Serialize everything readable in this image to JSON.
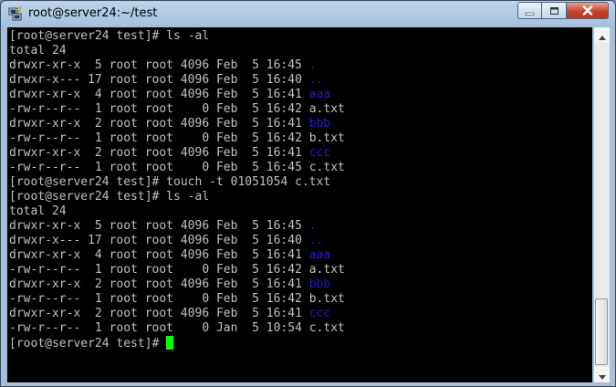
{
  "window": {
    "title": "root@server24:~/test"
  },
  "icons": {
    "app": "putty-icon",
    "minimize": "minimize-icon",
    "maximize": "maximize-icon",
    "close": "close-icon",
    "scroll_up": "arrow-up-icon",
    "scroll_down": "arrow-down-icon"
  },
  "colors": {
    "terminal_bg": "#000000",
    "terminal_fg": "#c0c0c0",
    "directory": "#1f1fcf",
    "cursor": "#00ff00",
    "close_button": "#c7452f"
  },
  "terminal": {
    "lines": [
      {
        "text": "[root@server24 test]# ls -al"
      },
      {
        "text": "total 24"
      },
      {
        "text": "drwxr-xr-x  5 root root 4096 Feb  5 16:45 ",
        "name": "."
      },
      {
        "text": "drwxr-x--- 17 root root 4096 Feb  5 16:40 ",
        "name": ".."
      },
      {
        "text": "drwxr-xr-x  4 root root 4096 Feb  5 16:41 ",
        "name": "aaa"
      },
      {
        "text": "-rw-r--r--  1 root root    0 Feb  5 16:42 a.txt"
      },
      {
        "text": "drwxr-xr-x  2 root root 4096 Feb  5 16:41 ",
        "name": "bbb"
      },
      {
        "text": "-rw-r--r--  1 root root    0 Feb  5 16:42 b.txt"
      },
      {
        "text": "drwxr-xr-x  2 root root 4096 Feb  5 16:41 ",
        "name": "ccc"
      },
      {
        "text": "-rw-r--r--  1 root root    0 Feb  5 16:45 c.txt"
      },
      {
        "text": "[root@server24 test]# touch -t 01051054 c.txt"
      },
      {
        "text": "[root@server24 test]# ls -al"
      },
      {
        "text": "total 24"
      },
      {
        "text": "drwxr-xr-x  5 root root 4096 Feb  5 16:45 ",
        "name": "."
      },
      {
        "text": "drwxr-x--- 17 root root 4096 Feb  5 16:40 ",
        "name": ".."
      },
      {
        "text": "drwxr-xr-x  4 root root 4096 Feb  5 16:41 ",
        "name": "aaa"
      },
      {
        "text": "-rw-r--r--  1 root root    0 Feb  5 16:42 a.txt"
      },
      {
        "text": "drwxr-xr-x  2 root root 4096 Feb  5 16:41 ",
        "name": "bbb"
      },
      {
        "text": "-rw-r--r--  1 root root    0 Feb  5 16:42 b.txt"
      },
      {
        "text": "drwxr-xr-x  2 root root 4096 Feb  5 16:41 ",
        "name": "ccc"
      },
      {
        "text": "-rw-r--r--  1 root root    0 Jan  5 10:54 c.txt"
      },
      {
        "text": "[root@server24 test]# ",
        "cursor": true
      }
    ]
  }
}
